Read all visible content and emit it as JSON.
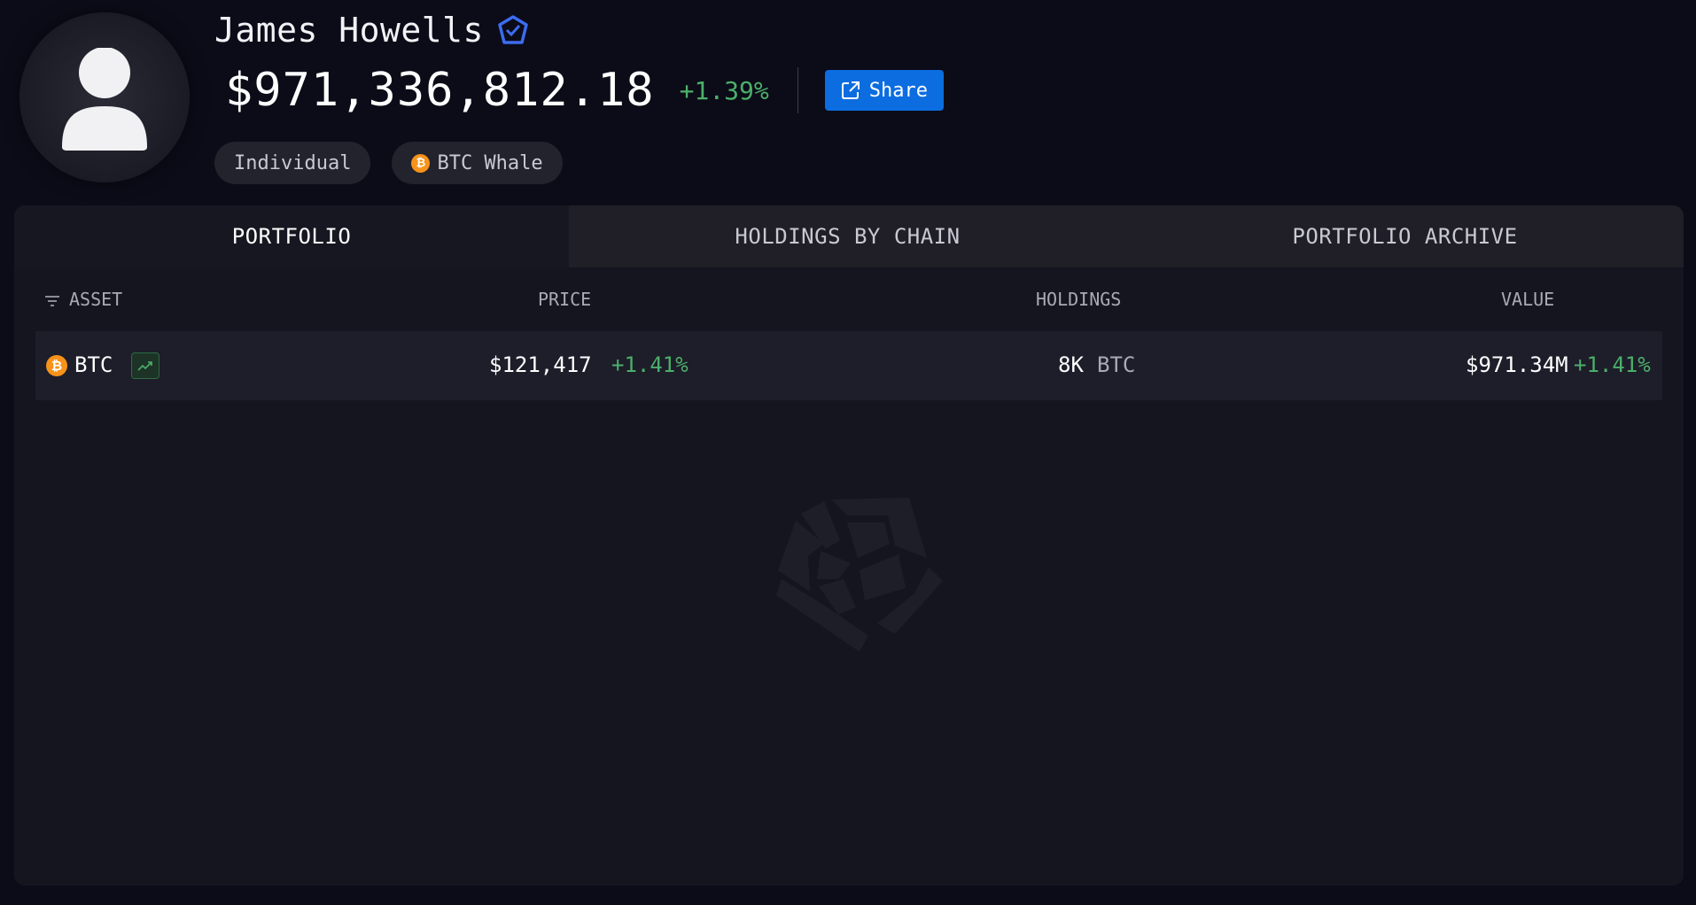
{
  "profile": {
    "name": "James Howells",
    "balance": "$971,336,812.18",
    "balance_change": "+1.39%",
    "share_label": "Share",
    "tags": [
      {
        "label": "Individual"
      },
      {
        "label": "BTC Whale",
        "icon": "bitcoin-icon"
      }
    ]
  },
  "tabs": [
    {
      "label": "PORTFOLIO",
      "active": true
    },
    {
      "label": "HOLDINGS BY CHAIN",
      "active": false
    },
    {
      "label": "PORTFOLIO ARCHIVE",
      "active": false
    }
  ],
  "table": {
    "headers": {
      "asset": "ASSET",
      "price": "PRICE",
      "holdings": "HOLDINGS",
      "value": "VALUE"
    },
    "rows": [
      {
        "asset": "BTC",
        "price": "$121,417",
        "price_change": "+1.41%",
        "holdings_amount": "8K",
        "holdings_unit": "BTC",
        "value": "$971.34M",
        "value_change": "+1.41%"
      }
    ]
  },
  "colors": {
    "background": "#0b0c18",
    "panel": "#14151f",
    "accent_blue": "#0b6de0",
    "positive": "#4caf6a",
    "bitcoin": "#f7931a",
    "verified": "#3d6cf0"
  }
}
